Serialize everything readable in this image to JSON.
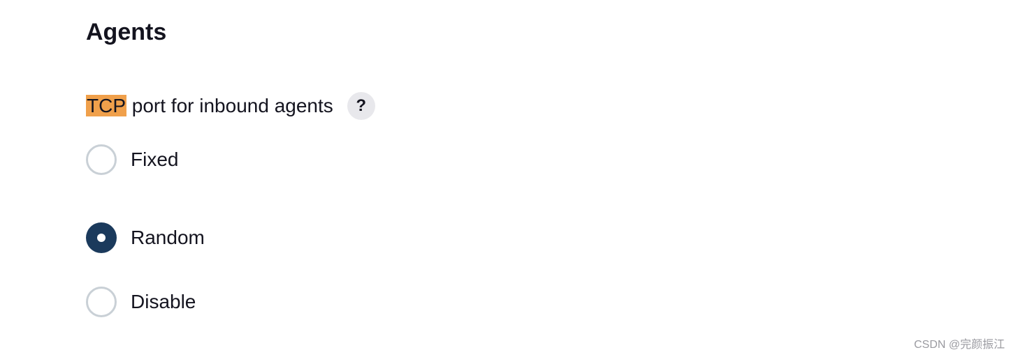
{
  "section": {
    "title": "Agents"
  },
  "field": {
    "label_highlight": "TCP",
    "label_rest": " port for inbound agents",
    "help_label": "?"
  },
  "options": [
    {
      "label": "Fixed",
      "checked": false
    },
    {
      "label": "Random",
      "checked": true
    },
    {
      "label": "Disable",
      "checked": false
    }
  ],
  "selected_option": "Random",
  "watermark": "CSDN @完颜振江",
  "colors": {
    "highlight": "#f0a04b",
    "radio_checked": "#1b3a5c",
    "radio_border": "#c9d0d6",
    "help_bg": "#e8e8ec",
    "text": "#14141f"
  },
  "icons": {
    "help": "question-mark-icon",
    "radio_selected": "radio-selected-icon",
    "radio_unselected": "radio-unselected-icon"
  }
}
